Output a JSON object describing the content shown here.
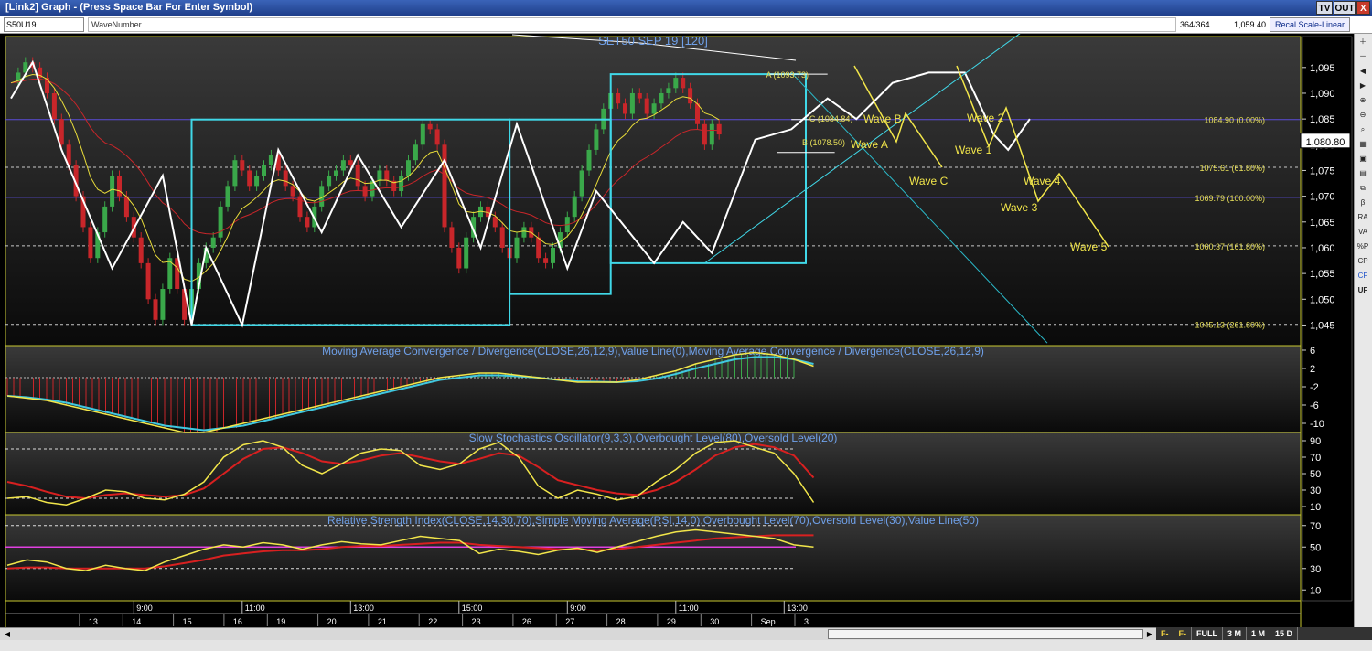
{
  "window": {
    "title": "[Link2] Graph  - (Press Space Bar For Enter Symbol)",
    "buttons": [
      "TV",
      "OUT",
      "X"
    ]
  },
  "toolbar": {
    "symbol": "S50U19",
    "study": "WaveNumber",
    "bar_count": "364/364",
    "last_value": "1,059.40",
    "scale_button": "Recal Scale-Linear"
  },
  "sidebar": {
    "tools": [
      "plus-icon",
      "minus-icon",
      "arrow-left-icon",
      "arrow-right-icon",
      "zoom-in-icon",
      "zoom-out-icon",
      "search-icon",
      "grid-icon",
      "lock-icon",
      "chart-icon",
      "link-icon",
      "beta",
      "RA",
      "VA",
      "%P",
      "CP",
      "CF",
      "UF"
    ],
    "labels": [
      "β",
      "RA",
      "VA",
      "%P",
      "CP",
      "CF",
      "UF"
    ]
  },
  "scrollbar": {
    "zoom_options": [
      "F-",
      "F-",
      "FULL",
      "3 M",
      "1 M",
      "15 D"
    ]
  },
  "colors": {
    "up_candle": "#3aa84a",
    "down_candle": "#c8262a",
    "wave_line": "#ffffff",
    "box": "#40d8e8",
    "fib_line": "#5a4cd8",
    "projection": "#f2e64a",
    "ema_fast": "#e8dc3a",
    "ema_slow": "#c8262a",
    "title_text": "#6fa0e8"
  },
  "chart_data": [
    {
      "type": "candlestick",
      "title": "SET50 SEP 19   [120]",
      "ylim": [
        1041,
        1101
      ],
      "y_ticks": [
        "1,095",
        "1,090",
        "1,085",
        "1,080",
        "1,075",
        "1,070",
        "1,065",
        "1,060",
        "1,055",
        "1,050",
        "1,045"
      ],
      "last_price_label": "1,080.80",
      "x_time_labels": [
        {
          "label": "9:00",
          "i": 17
        },
        {
          "label": "11:00",
          "i": 32
        },
        {
          "label": "13:00",
          "i": 47
        },
        {
          "label": "15:00",
          "i": 62
        },
        {
          "label": "9:00",
          "i": 77
        },
        {
          "label": "11:00",
          "i": 92
        },
        {
          "label": "13:00",
          "i": 107
        }
      ],
      "x_date_labels": [
        {
          "label": "13",
          "i": 11
        },
        {
          "label": "14",
          "i": 17
        },
        {
          "label": "15",
          "i": 24
        },
        {
          "label": "16",
          "i": 31
        },
        {
          "label": "19",
          "i": 37
        },
        {
          "label": "20",
          "i": 44
        },
        {
          "label": "21",
          "i": 51
        },
        {
          "label": "22",
          "i": 58
        },
        {
          "label": "23",
          "i": 64
        },
        {
          "label": "26",
          "i": 71
        },
        {
          "label": "27",
          "i": 77
        },
        {
          "label": "28",
          "i": 84
        },
        {
          "label": "29",
          "i": 91
        },
        {
          "label": "30",
          "i": 97
        },
        {
          "label": "Sep",
          "i": 104
        },
        {
          "label": "3",
          "i": 110
        }
      ],
      "closes": [
        1092,
        1094,
        1096,
        1095,
        1093,
        1090,
        1085,
        1080,
        1076,
        1070,
        1064,
        1058,
        1063,
        1068,
        1074,
        1070,
        1066,
        1062,
        1057,
        1050,
        1046,
        1052,
        1058,
        1052,
        1046,
        1052,
        1057,
        1060,
        1062,
        1068,
        1072,
        1077,
        1075,
        1072,
        1074,
        1076,
        1078,
        1075,
        1072,
        1070,
        1066,
        1064,
        1068,
        1072,
        1074,
        1075,
        1077,
        1076,
        1072,
        1070,
        1073,
        1075,
        1073,
        1071,
        1074,
        1077,
        1080,
        1084,
        1083,
        1080,
        1064,
        1060,
        1056,
        1062,
        1066,
        1068,
        1066,
        1064,
        1060,
        1058,
        1062,
        1064,
        1062,
        1058,
        1057,
        1060,
        1063,
        1066,
        1070,
        1075,
        1079,
        1083,
        1087,
        1090,
        1088,
        1086,
        1090,
        1089,
        1086,
        1088,
        1090,
        1091,
        1093,
        1091,
        1088,
        1084,
        1080,
        1084,
        1082
      ],
      "fib_levels": [
        {
          "value": 1084.9,
          "label": "1084.90 (0.00%)",
          "style": "solid"
        },
        {
          "value": 1075.61,
          "label": "1075.61 (61.80%)",
          "style": "dashed"
        },
        {
          "value": 1069.79,
          "label": "1069.79 (100.00%)",
          "style": "solid"
        },
        {
          "value": 1060.37,
          "label": "1060.37 (161.80%)",
          "style": "dashed"
        },
        {
          "value": 1045.13,
          "label": "1045.13 (261.80%)",
          "style": "dashed"
        }
      ],
      "abc_labels": [
        {
          "label": "A (1093.73)",
          "i": 105,
          "value": 1093.73
        },
        {
          "label": "B (1078.50)",
          "i": 110,
          "value": 1078.5
        },
        {
          "label": "C (1084.84)",
          "i": 111,
          "value": 1084.84
        }
      ],
      "wave_points": [
        [
          0,
          1089
        ],
        [
          3,
          1096
        ],
        [
          7,
          1079
        ],
        [
          14,
          1056
        ],
        [
          21,
          1074
        ],
        [
          25,
          1045
        ],
        [
          27,
          1060
        ],
        [
          32,
          1045
        ],
        [
          37,
          1079
        ],
        [
          43,
          1063
        ],
        [
          48,
          1078
        ],
        [
          54,
          1064
        ],
        [
          60,
          1077
        ],
        [
          65,
          1060
        ],
        [
          70,
          1084
        ],
        [
          77,
          1056
        ],
        [
          81,
          1071
        ],
        [
          89,
          1057
        ],
        [
          93,
          1065
        ],
        [
          97,
          1059
        ],
        [
          103,
          1081
        ],
        [
          108,
          1083
        ],
        [
          113,
          1089
        ],
        [
          117,
          1085
        ],
        [
          122,
          1092
        ],
        [
          127,
          1094
        ],
        [
          132,
          1094
        ],
        [
          136,
          1082
        ],
        [
          138,
          1079
        ],
        [
          141,
          1085
        ]
      ],
      "boxes": [
        {
          "i0": 25,
          "i1": 69,
          "top": 1084.9,
          "bottom": 1045
        },
        {
          "i0": 69,
          "i1": 83,
          "top": 1084.9,
          "bottom": 1051
        },
        {
          "i0": 83,
          "i1": 110,
          "top": 1093.7,
          "bottom": 1057
        }
      ],
      "projections": [
        {
          "points": [
            [
              934,
              72
            ],
            [
              980,
              155
            ],
            [
              990,
              124
            ],
            [
              1030,
              183
            ]
          ],
          "labels": [
            {
              "text": "Wave B",
              "x": 944,
              "y": 134
            },
            {
              "text": "Wave A",
              "x": 930,
              "y": 162
            },
            {
              "text": "Wave C",
              "x": 994,
              "y": 202
            }
          ]
        },
        {
          "points": [
            [
              1046,
              72
            ],
            [
              1081,
              160
            ],
            [
              1100,
              118
            ],
            [
              1135,
              220
            ],
            [
              1158,
              190
            ],
            [
              1212,
              270
            ]
          ],
          "labels": [
            {
              "text": "Wave 2",
              "x": 1057,
              "y": 133
            },
            {
              "text": "Wave 1",
              "x": 1044,
              "y": 168
            },
            {
              "text": "Wave 4",
              "x": 1119,
              "y": 202
            },
            {
              "text": "Wave 3",
              "x": 1094,
              "y": 231
            },
            {
              "text": "Wave 5",
              "x": 1170,
              "y": 274
            }
          ]
        }
      ]
    },
    {
      "type": "line",
      "title": "Moving Average Convergence / Divergence(CLOSE,26,12,9),Value Line(0),Moving Average Convergence / Divergence(CLOSE,26,12,9)",
      "y_ticks": [
        "6",
        "2",
        "-2",
        "-6",
        "-10"
      ],
      "ylim": [
        -12,
        7
      ],
      "series": [
        {
          "values": [
            -4,
            -4.5,
            -5,
            -6,
            -7,
            -8,
            -9,
            -10,
            -11,
            -12,
            -12,
            -11,
            -10,
            -9,
            -8,
            -7,
            -6,
            -5,
            -4,
            -3,
            -2,
            -1,
            0,
            0.5,
            1,
            1,
            0.5,
            0,
            -0.5,
            -1,
            -1,
            -1,
            -0.5,
            0.5,
            1.5,
            3,
            4,
            5,
            5.5,
            5,
            4,
            2.5
          ]
        },
        {
          "values": [
            -4,
            -4.3,
            -4.8,
            -5.5,
            -6.5,
            -7.5,
            -8.5,
            -9.5,
            -10.5,
            -11,
            -11.5,
            -11,
            -10.5,
            -9.5,
            -8.5,
            -7.5,
            -6.5,
            -5.5,
            -4.5,
            -3.5,
            -2.5,
            -1.5,
            -0.5,
            0,
            0.5,
            0.5,
            0.3,
            0,
            -0.5,
            -0.8,
            -0.9,
            -1,
            -0.8,
            -0.2,
            0.8,
            2,
            3,
            4,
            4.5,
            4.5,
            4,
            3
          ]
        }
      ]
    },
    {
      "type": "line",
      "title": "Slow Stochastics Oscillator(9,3,3),Overbought Level(80),Oversold Level(20)",
      "y_ticks": [
        "90",
        "70",
        "50",
        "30",
        "10"
      ],
      "ylim": [
        0,
        100
      ],
      "series": [
        {
          "values": [
            20,
            22,
            15,
            12,
            20,
            30,
            28,
            20,
            18,
            25,
            40,
            70,
            85,
            90,
            82,
            60,
            50,
            62,
            75,
            80,
            78,
            60,
            55,
            62,
            80,
            88,
            70,
            35,
            20,
            30,
            25,
            18,
            22,
            40,
            55,
            75,
            88,
            90,
            82,
            75,
            50,
            15
          ]
        },
        {
          "values": [
            40,
            35,
            28,
            22,
            20,
            24,
            26,
            24,
            22,
            24,
            32,
            50,
            68,
            80,
            82,
            75,
            65,
            62,
            66,
            72,
            75,
            70,
            65,
            62,
            68,
            75,
            72,
            58,
            42,
            36,
            30,
            26,
            24,
            30,
            40,
            55,
            72,
            82,
            86,
            82,
            72,
            45
          ]
        }
      ]
    },
    {
      "type": "line",
      "title": "Relative Strength Index(CLOSE,14,30,70),Simple Moving Average(RSI,14,0),Overbought Level(70),Oversold Level(30),Value Line(50)",
      "y_ticks": [
        "70",
        "50",
        "30",
        "10"
      ],
      "ylim": [
        0,
        80
      ],
      "series": [
        {
          "values": [
            33,
            38,
            36,
            30,
            28,
            33,
            30,
            28,
            36,
            42,
            48,
            52,
            50,
            54,
            52,
            48,
            52,
            55,
            53,
            52,
            56,
            60,
            58,
            56,
            44,
            48,
            46,
            43,
            47,
            49,
            45,
            50,
            55,
            60,
            64,
            66,
            64,
            62,
            60,
            58,
            52,
            50
          ]
        },
        {
          "values": [
            30,
            31,
            31,
            30,
            30,
            30,
            30,
            30,
            32,
            35,
            38,
            42,
            44,
            46,
            47,
            47,
            48,
            50,
            51,
            51,
            52,
            53,
            54,
            54,
            52,
            51,
            50,
            49,
            48,
            48,
            47,
            48,
            50,
            52,
            54,
            56,
            58,
            59,
            60,
            61,
            61,
            61
          ]
        }
      ]
    }
  ]
}
